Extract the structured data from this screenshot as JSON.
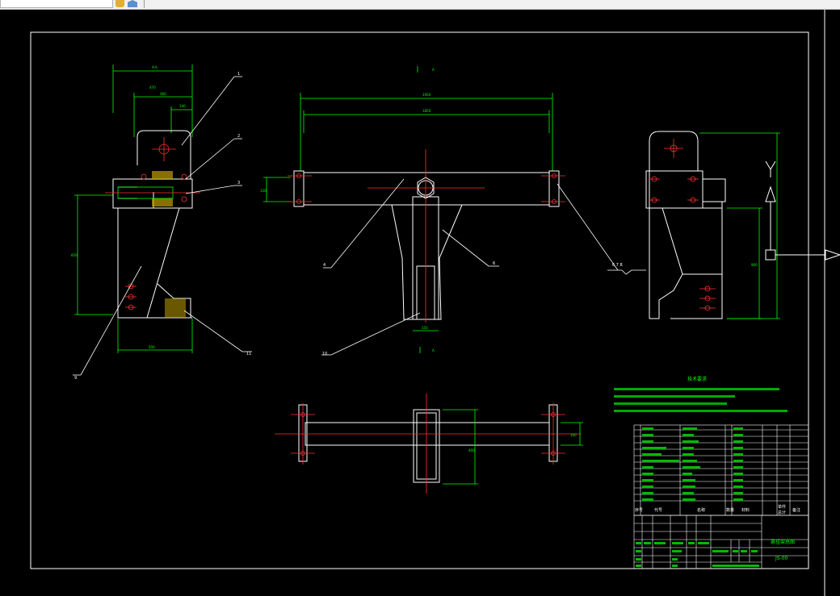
{
  "toolbar": {
    "icons": [
      "open-file-icon",
      "cube-3d-icon"
    ]
  },
  "drawing": {
    "colors": {
      "background": "#000000",
      "frame": "#ffffff",
      "dimension": "#00ff00",
      "centerline": "#ff3030",
      "section": "#ffff00",
      "outline": "#ffffff"
    },
    "balloons": [
      "1",
      "2",
      "3",
      "4",
      "6",
      "7",
      "8",
      "9",
      "10",
      "11",
      "6 7 8"
    ],
    "title_block": {
      "part_name": "悬挂架总图",
      "drawing_no": "JS-00",
      "col_headers": [
        "序号",
        "代号",
        "名称",
        "数量",
        "材料",
        "单件",
        "总计",
        "备注"
      ]
    },
    "tech_requirements": {
      "title": "技术要求"
    }
  }
}
